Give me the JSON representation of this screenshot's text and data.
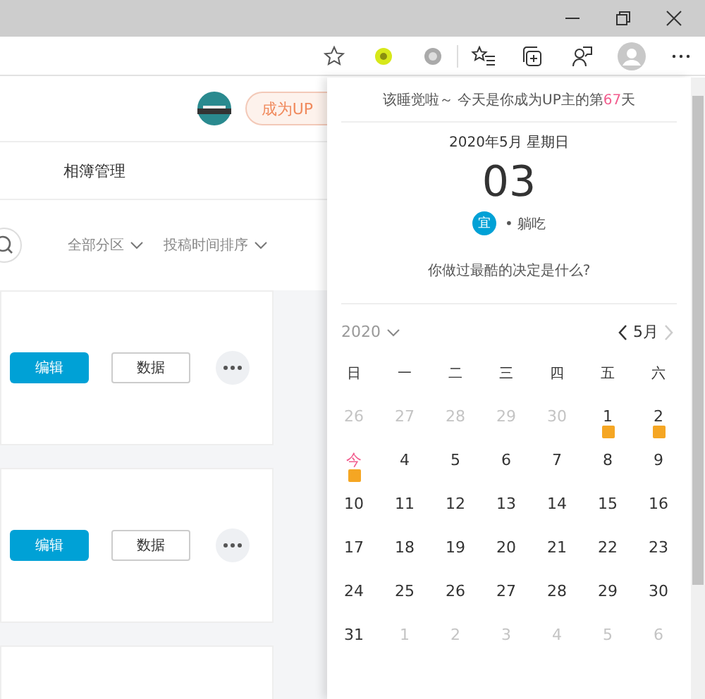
{
  "header": {
    "become_up_button": "成为UP"
  },
  "tabs": [
    {
      "label": "相簿管理",
      "selected": false
    }
  ],
  "filters": [
    {
      "label": "全部分区"
    },
    {
      "label": "投稿时间排序"
    }
  ],
  "cards": [
    {
      "kind": "actions",
      "edit": "编辑",
      "data": "数据"
    },
    {
      "kind": "actions",
      "edit": "编辑",
      "data": "数据"
    },
    {
      "kind": "blank"
    }
  ],
  "popup": {
    "greeting_before": "该睡觉啦～ 今天是你成为UP主的第",
    "greeting_count": "67",
    "greeting_after": "天",
    "date_line": "2020年5月 星期日",
    "day": "03",
    "yi_badge": "宜",
    "yi_text": "• 躺吃",
    "question": "你做过最酷的决定是什么?",
    "year": "2020",
    "month": "5月",
    "weekdays": [
      "日",
      "一",
      "二",
      "三",
      "四",
      "五",
      "六"
    ],
    "days": [
      {
        "label": "26",
        "muted": true,
        "today": false,
        "holiday": false
      },
      {
        "label": "27",
        "muted": true,
        "today": false,
        "holiday": false
      },
      {
        "label": "28",
        "muted": true,
        "today": false,
        "holiday": false
      },
      {
        "label": "29",
        "muted": true,
        "today": false,
        "holiday": false
      },
      {
        "label": "30",
        "muted": true,
        "today": false,
        "holiday": false
      },
      {
        "label": "1",
        "muted": false,
        "today": false,
        "holiday": true
      },
      {
        "label": "2",
        "muted": false,
        "today": false,
        "holiday": true
      },
      {
        "label": "今",
        "muted": false,
        "today": true,
        "holiday": true
      },
      {
        "label": "4",
        "muted": false,
        "today": false,
        "holiday": false
      },
      {
        "label": "5",
        "muted": false,
        "today": false,
        "holiday": false
      },
      {
        "label": "6",
        "muted": false,
        "today": false,
        "holiday": false
      },
      {
        "label": "7",
        "muted": false,
        "today": false,
        "holiday": false
      },
      {
        "label": "8",
        "muted": false,
        "today": false,
        "holiday": false
      },
      {
        "label": "9",
        "muted": false,
        "today": false,
        "holiday": false
      },
      {
        "label": "10",
        "muted": false,
        "today": false,
        "holiday": false
      },
      {
        "label": "11",
        "muted": false,
        "today": false,
        "holiday": false
      },
      {
        "label": "12",
        "muted": false,
        "today": false,
        "holiday": false
      },
      {
        "label": "13",
        "muted": false,
        "today": false,
        "holiday": false
      },
      {
        "label": "14",
        "muted": false,
        "today": false,
        "holiday": false
      },
      {
        "label": "15",
        "muted": false,
        "today": false,
        "holiday": false
      },
      {
        "label": "16",
        "muted": false,
        "today": false,
        "holiday": false
      },
      {
        "label": "17",
        "muted": false,
        "today": false,
        "holiday": false
      },
      {
        "label": "18",
        "muted": false,
        "today": false,
        "holiday": false
      },
      {
        "label": "19",
        "muted": false,
        "today": false,
        "holiday": false
      },
      {
        "label": "20",
        "muted": false,
        "today": false,
        "holiday": false
      },
      {
        "label": "21",
        "muted": false,
        "today": false,
        "holiday": false
      },
      {
        "label": "22",
        "muted": false,
        "today": false,
        "holiday": false
      },
      {
        "label": "23",
        "muted": false,
        "today": false,
        "holiday": false
      },
      {
        "label": "24",
        "muted": false,
        "today": false,
        "holiday": false
      },
      {
        "label": "25",
        "muted": false,
        "today": false,
        "holiday": false
      },
      {
        "label": "26",
        "muted": false,
        "today": false,
        "holiday": false
      },
      {
        "label": "27",
        "muted": false,
        "today": false,
        "holiday": false
      },
      {
        "label": "28",
        "muted": false,
        "today": false,
        "holiday": false
      },
      {
        "label": "29",
        "muted": false,
        "today": false,
        "holiday": false
      },
      {
        "label": "30",
        "muted": false,
        "today": false,
        "holiday": false
      },
      {
        "label": "31",
        "muted": false,
        "today": false,
        "holiday": false
      },
      {
        "label": "1",
        "muted": true,
        "today": false,
        "holiday": false
      },
      {
        "label": "2",
        "muted": true,
        "today": false,
        "holiday": false
      },
      {
        "label": "3",
        "muted": true,
        "today": false,
        "holiday": false
      },
      {
        "label": "4",
        "muted": true,
        "today": false,
        "holiday": false
      },
      {
        "label": "5",
        "muted": true,
        "today": false,
        "holiday": false
      },
      {
        "label": "6",
        "muted": true,
        "today": false,
        "holiday": false
      }
    ]
  }
}
